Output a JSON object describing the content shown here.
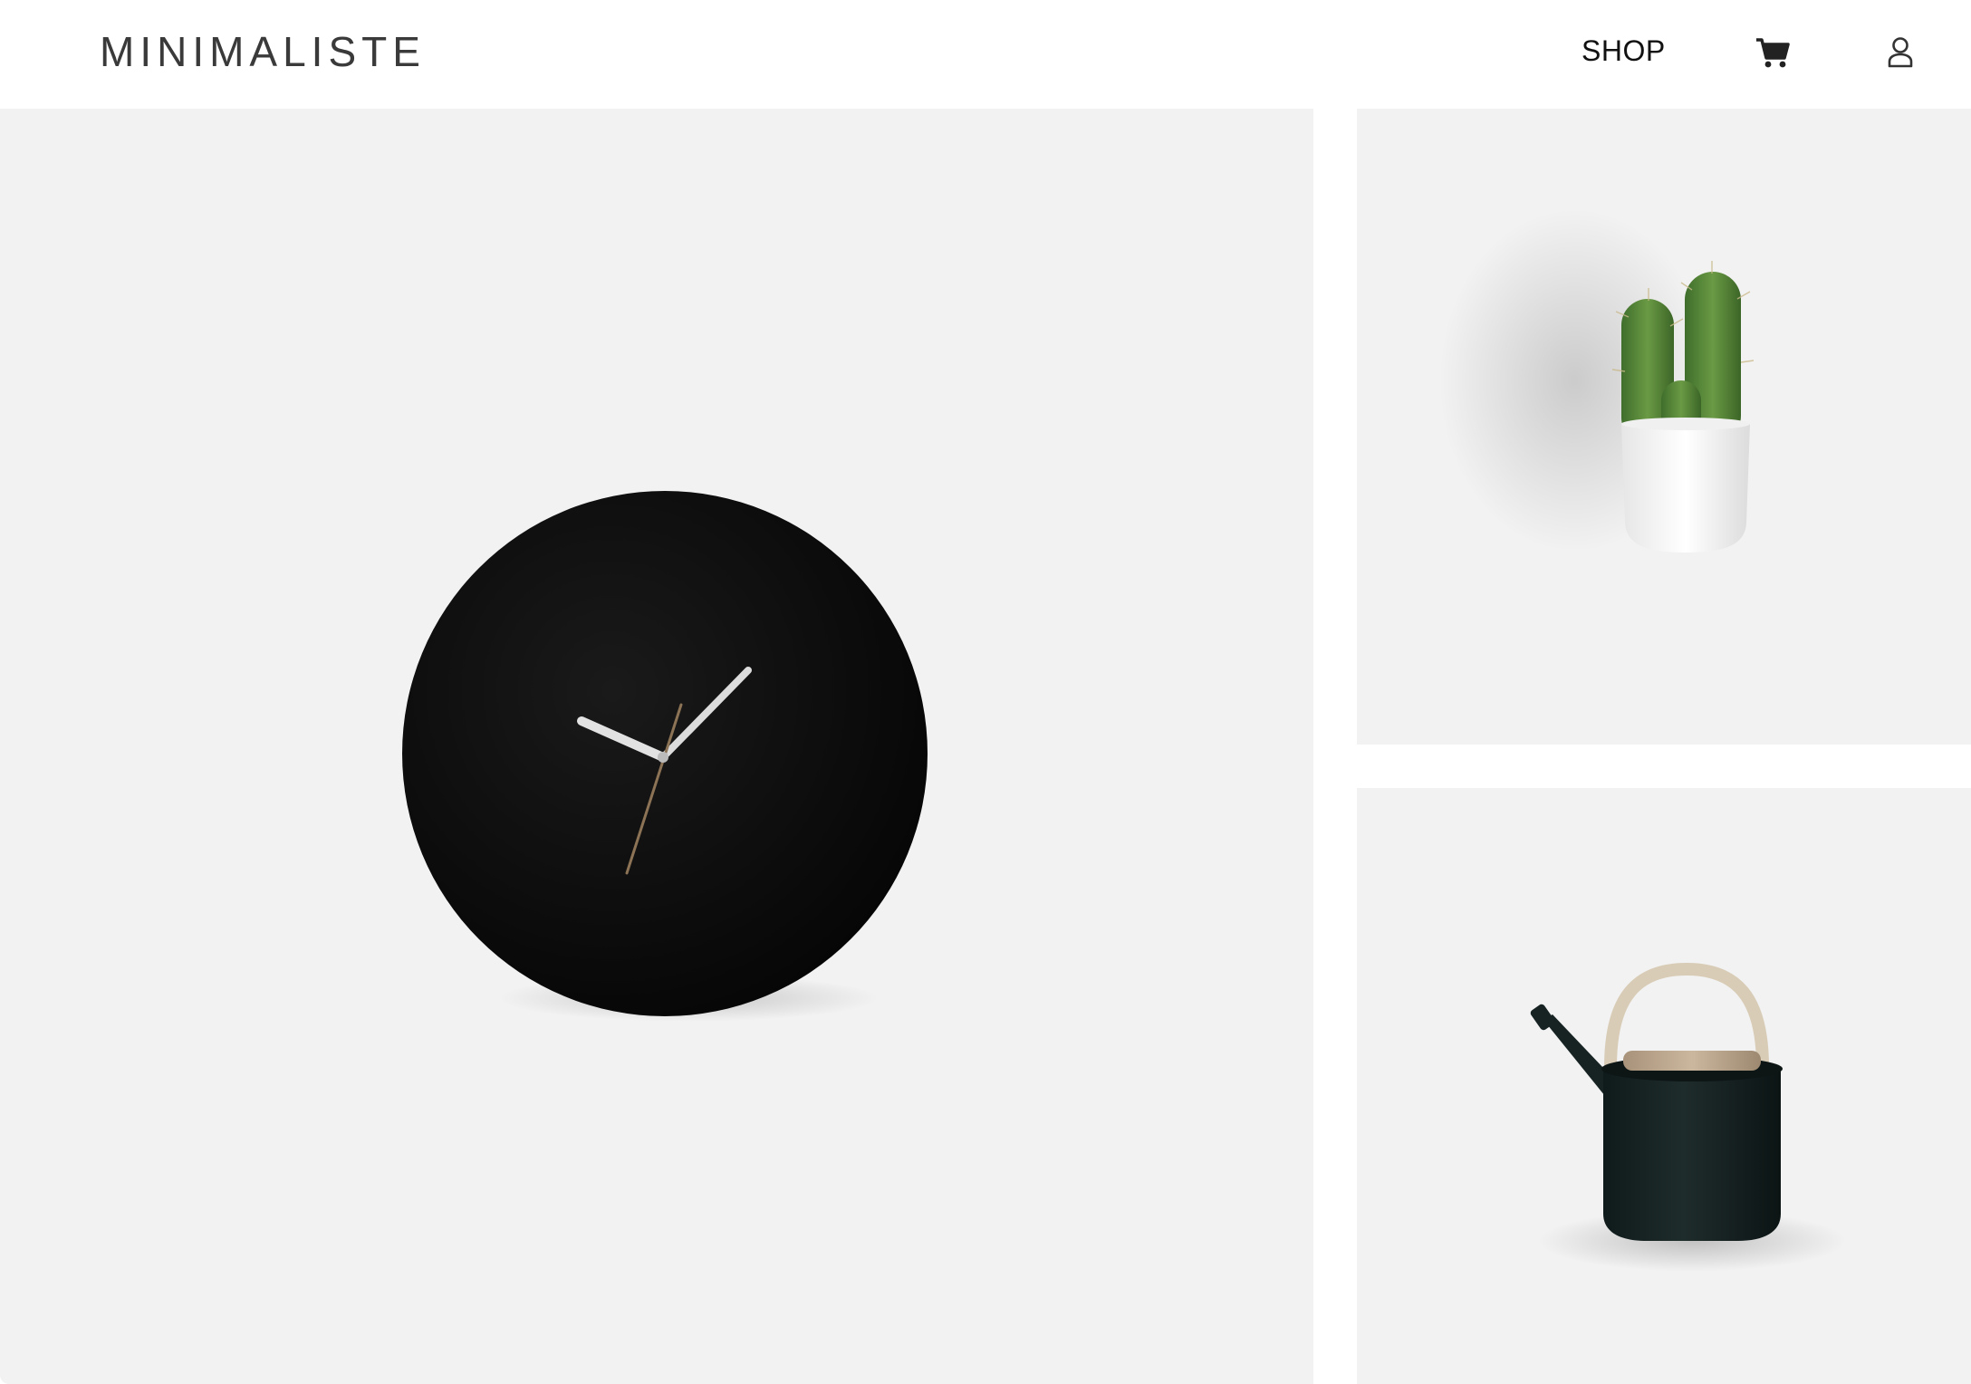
{
  "header": {
    "logo_text": "MINIMALISTE",
    "nav": {
      "shop_label": "SHOP",
      "cart_icon": "cart-icon",
      "account_icon": "user-icon"
    }
  },
  "products": [
    {
      "name": "clock",
      "image": "black-wall-clock"
    },
    {
      "name": "cactus",
      "image": "cactus-in-white-pot"
    },
    {
      "name": "kettle",
      "image": "black-teapot-with-wooden-handle"
    }
  ],
  "colors": {
    "background": "#ffffff",
    "tile_background": "#f2f2f2",
    "text": "#3a3a3a"
  }
}
